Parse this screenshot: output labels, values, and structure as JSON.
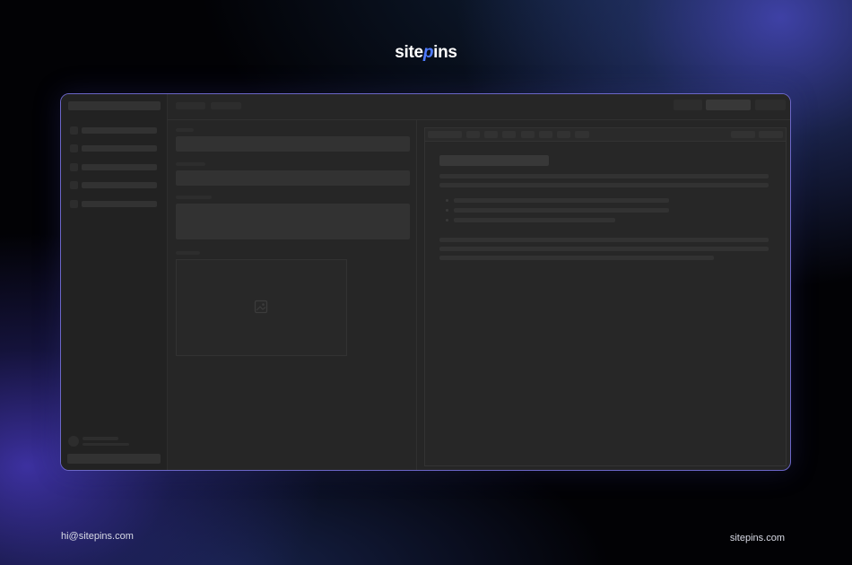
{
  "brand": {
    "logo_prefix": "site",
    "logo_accent": "p",
    "logo_suffix": "ins"
  },
  "footer": {
    "email": "hi@sitepins.com",
    "website": "sitepins.com"
  },
  "colors": {
    "frame_border": "#6b66c8",
    "logo_accent": "#4f7bff",
    "mock_bg": "#262626"
  },
  "icons": {
    "image_placeholder": "image-placeholder-icon"
  }
}
